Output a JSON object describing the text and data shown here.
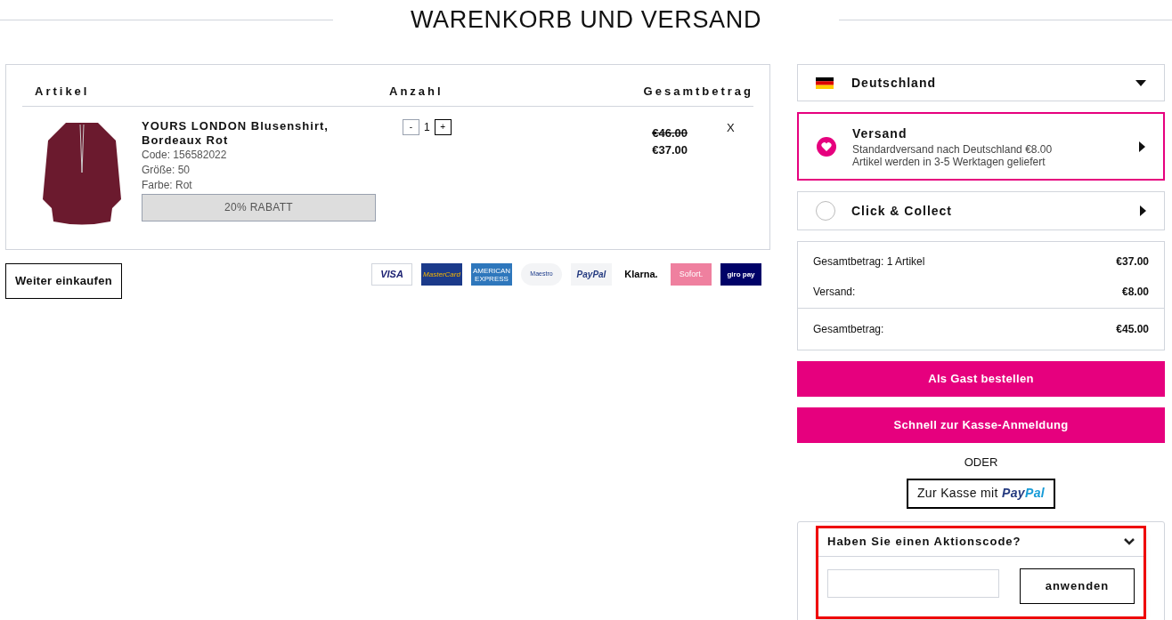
{
  "title": "WARENKORB UND VERSAND",
  "cart": {
    "columns": [
      "Artikel",
      "Anzahl",
      "Gesamtbetrag"
    ],
    "items": [
      {
        "name": "YOURS LONDON Blusenshirt, Bordeaux Rot",
        "details": [
          "Code: 156582022",
          "Größe: 50",
          "Farbe: Rot"
        ],
        "discount": "20% RABATT",
        "minus": "-",
        "quantity": "1",
        "plus": "+",
        "old_price": "€46.00",
        "price": "€37.00",
        "remove": "X"
      }
    ]
  },
  "continue_button": "Weiter einkaufen",
  "payment_methods": [
    {
      "kind": "visa",
      "label": "VISA"
    },
    {
      "kind": "mastercard",
      "label": "MasterCard"
    },
    {
      "kind": "amex",
      "label": "AMERICAN EXPRESS"
    },
    {
      "kind": "maestro",
      "label": "Maestro"
    },
    {
      "kind": "paypal",
      "label": "PayPal"
    },
    {
      "kind": "klarna",
      "label": "Klarna."
    },
    {
      "kind": "sofort",
      "label": "Sofort."
    },
    {
      "kind": "giropay",
      "label": "giro pay"
    }
  ],
  "country": {
    "label": "Deutschland"
  },
  "delivery_options": [
    {
      "title": "Versand",
      "lines": [
        "Standardversand nach Deutschland €8.00",
        "Artikel werden in 3-5 Werktagen geliefert"
      ],
      "selected": true
    },
    {
      "title": "Click & Collect",
      "selected": false
    }
  ],
  "summary": [
    {
      "label": "Gesamtbetrag: 1 Artikel",
      "value": "€37.00"
    },
    {
      "label": "Versand:",
      "value": "€8.00"
    },
    {
      "label": "Gesamtbetrag:",
      "value": "€45.00",
      "total": true
    }
  ],
  "buttons": [
    "Als Gast bestellen",
    "Schnell zur Kasse-Anmeldung"
  ],
  "or_label": "ODER",
  "paypal_button": {
    "text": "Zur Kasse mit",
    "brand_dark": "Pay",
    "brand_light": "Pal"
  },
  "promo": {
    "title": "Haben Sie einen Aktionscode?",
    "expanded": true,
    "highlighted": true,
    "apply": "anwenden"
  }
}
